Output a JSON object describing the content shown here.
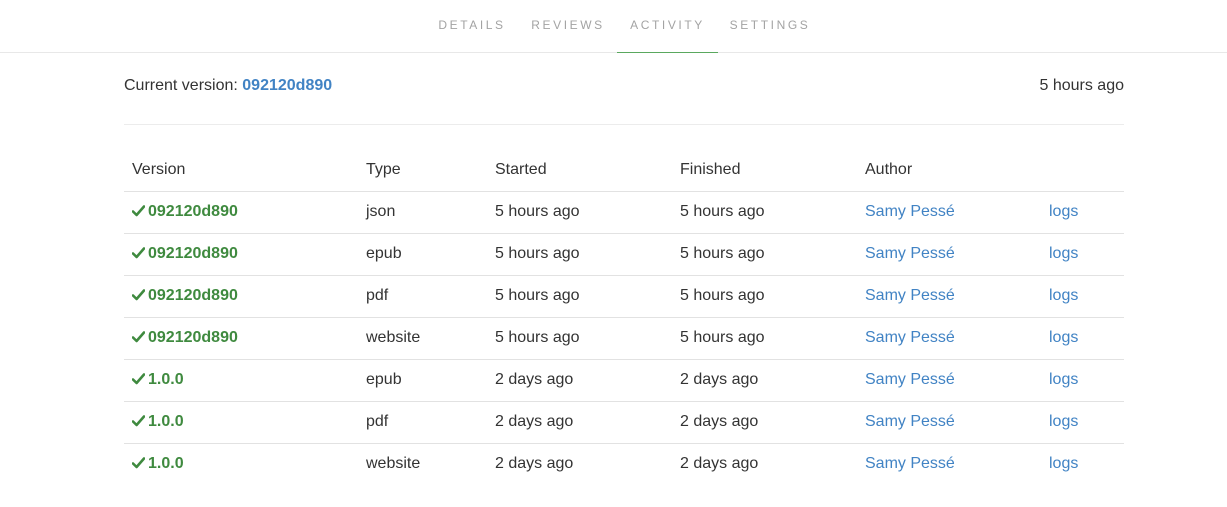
{
  "nav": {
    "tabs": [
      {
        "label": "DETAILS"
      },
      {
        "label": "REVIEWS"
      },
      {
        "label": "ACTIVITY"
      },
      {
        "label": "SETTINGS"
      }
    ],
    "active_tab": "ACTIVITY"
  },
  "current_version": {
    "label": "Current version:",
    "value": "092120d890",
    "time": "5 hours ago"
  },
  "table": {
    "headers": [
      "Version",
      "Type",
      "Started",
      "Finished",
      "Author",
      ""
    ],
    "rows": [
      {
        "version": "092120d890",
        "type": "json",
        "started": "5 hours ago",
        "finished": "5 hours ago",
        "author": "Samy Pessé",
        "logs": "logs"
      },
      {
        "version": "092120d890",
        "type": "epub",
        "started": "5 hours ago",
        "finished": "5 hours ago",
        "author": "Samy Pessé",
        "logs": "logs"
      },
      {
        "version": "092120d890",
        "type": "pdf",
        "started": "5 hours ago",
        "finished": "5 hours ago",
        "author": "Samy Pessé",
        "logs": "logs"
      },
      {
        "version": "092120d890",
        "type": "website",
        "started": "5 hours ago",
        "finished": "5 hours ago",
        "author": "Samy Pessé",
        "logs": "logs"
      },
      {
        "version": "1.0.0",
        "type": "epub",
        "started": "2 days ago",
        "finished": "2 days ago",
        "author": "Samy Pessé",
        "logs": "logs"
      },
      {
        "version": "1.0.0",
        "type": "pdf",
        "started": "2 days ago",
        "finished": "2 days ago",
        "author": "Samy Pessé",
        "logs": "logs"
      },
      {
        "version": "1.0.0",
        "type": "website",
        "started": "2 days ago",
        "finished": "2 days ago",
        "author": "Samy Pessé",
        "logs": "logs"
      }
    ]
  },
  "icons": {
    "status": "check-icon"
  },
  "colors": {
    "success": "#3f8a3f",
    "link": "#4183c4",
    "active_tab_underline": "#5aa85e",
    "tab_text": "#a3a3a3"
  }
}
